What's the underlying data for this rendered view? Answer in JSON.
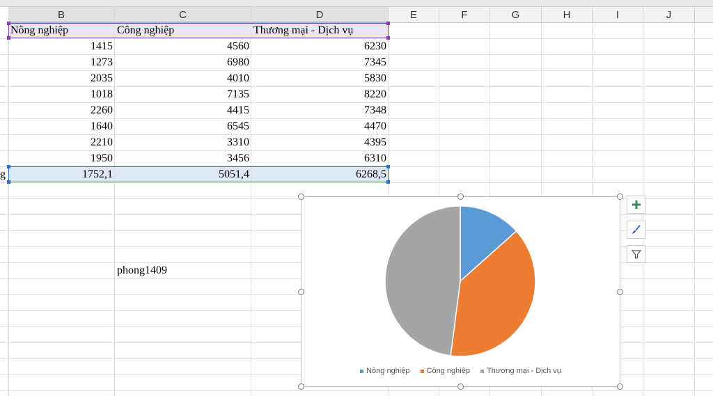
{
  "columns": [
    "B",
    "C",
    "D",
    "E",
    "F",
    "G",
    "H",
    "I",
    "J"
  ],
  "table": {
    "headers": [
      "Nông nghiệp",
      "Công nghiệp",
      "Thương mại - Dịch vụ"
    ],
    "rows": [
      [
        "1415",
        "4560",
        "6230"
      ],
      [
        "1273",
        "6980",
        "7345"
      ],
      [
        "2035",
        "4010",
        "5830"
      ],
      [
        "1018",
        "7135",
        "8220"
      ],
      [
        "2260",
        "4415",
        "7348"
      ],
      [
        "1640",
        "6545",
        "4470"
      ],
      [
        "2210",
        "3310",
        "4395"
      ],
      [
        "1950",
        "3456",
        "6310"
      ]
    ],
    "average_label_fragment": "g",
    "averages": [
      "1752,1",
      "5051,4",
      "6268,5"
    ]
  },
  "note_cell": "phong1409",
  "chart_data": {
    "type": "pie",
    "categories": [
      "Nông nghiệp",
      "Công nghiệp",
      "Thương mại - Dịch vụ"
    ],
    "values": [
      1752.1,
      5051.4,
      6268.5
    ],
    "colors": [
      "#5b9bd5",
      "#ed7d31",
      "#a5a5a5"
    ],
    "legend": "bottom",
    "title": ""
  },
  "chart_tools": [
    {
      "icon": "plus-icon",
      "name": "chart-elements"
    },
    {
      "icon": "brush-icon",
      "name": "chart-styles"
    },
    {
      "icon": "filter-icon",
      "name": "chart-filters"
    }
  ]
}
